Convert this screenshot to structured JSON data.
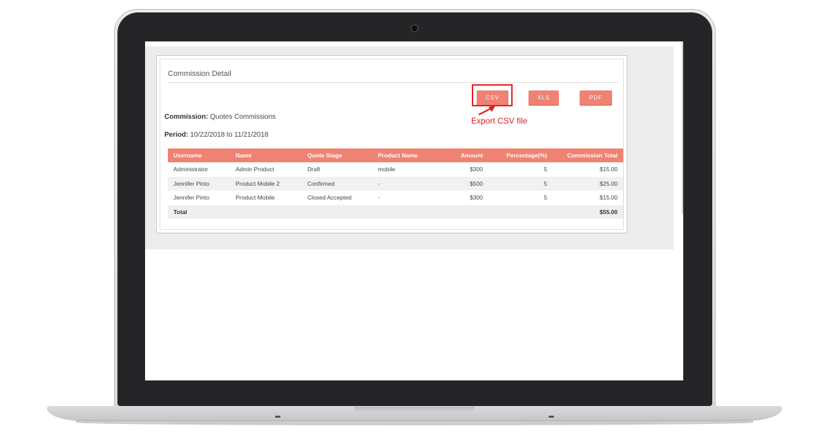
{
  "panel": {
    "title": "Commission Detail"
  },
  "toolbar": {
    "csv_label": "CSV",
    "xls_label": "XLS",
    "pdf_label": "PDF"
  },
  "annotation": {
    "text": "Export CSV file",
    "color": "#e51c1c"
  },
  "meta": {
    "commission_label": "Commission:",
    "commission_value": "Quotes Commissions",
    "period_label": "Period:",
    "period_value": "10/22/2018 to 11/21/2018"
  },
  "table": {
    "headers": [
      "Username",
      "Name",
      "Quote Stage",
      "Product Name",
      "Amount",
      "Percentage(%)",
      "Commission Total"
    ],
    "rows": [
      [
        "Administrator",
        "Admin Product",
        "Draft",
        "mobile",
        "$300",
        "5",
        "$15.00"
      ],
      [
        "Jennifer Pinto",
        "Product Mobile 2",
        "Confirmed",
        "-",
        "$500",
        "5",
        "$25.00"
      ],
      [
        "Jennifer Pinto",
        "Product Mobile",
        "Closed Accepted",
        "-",
        "$300",
        "5",
        "$15.00"
      ]
    ],
    "total_label": "Total",
    "total_value": "$55.00"
  },
  "colors": {
    "accent": "#ef8273",
    "highlight": "#e51c1c"
  }
}
